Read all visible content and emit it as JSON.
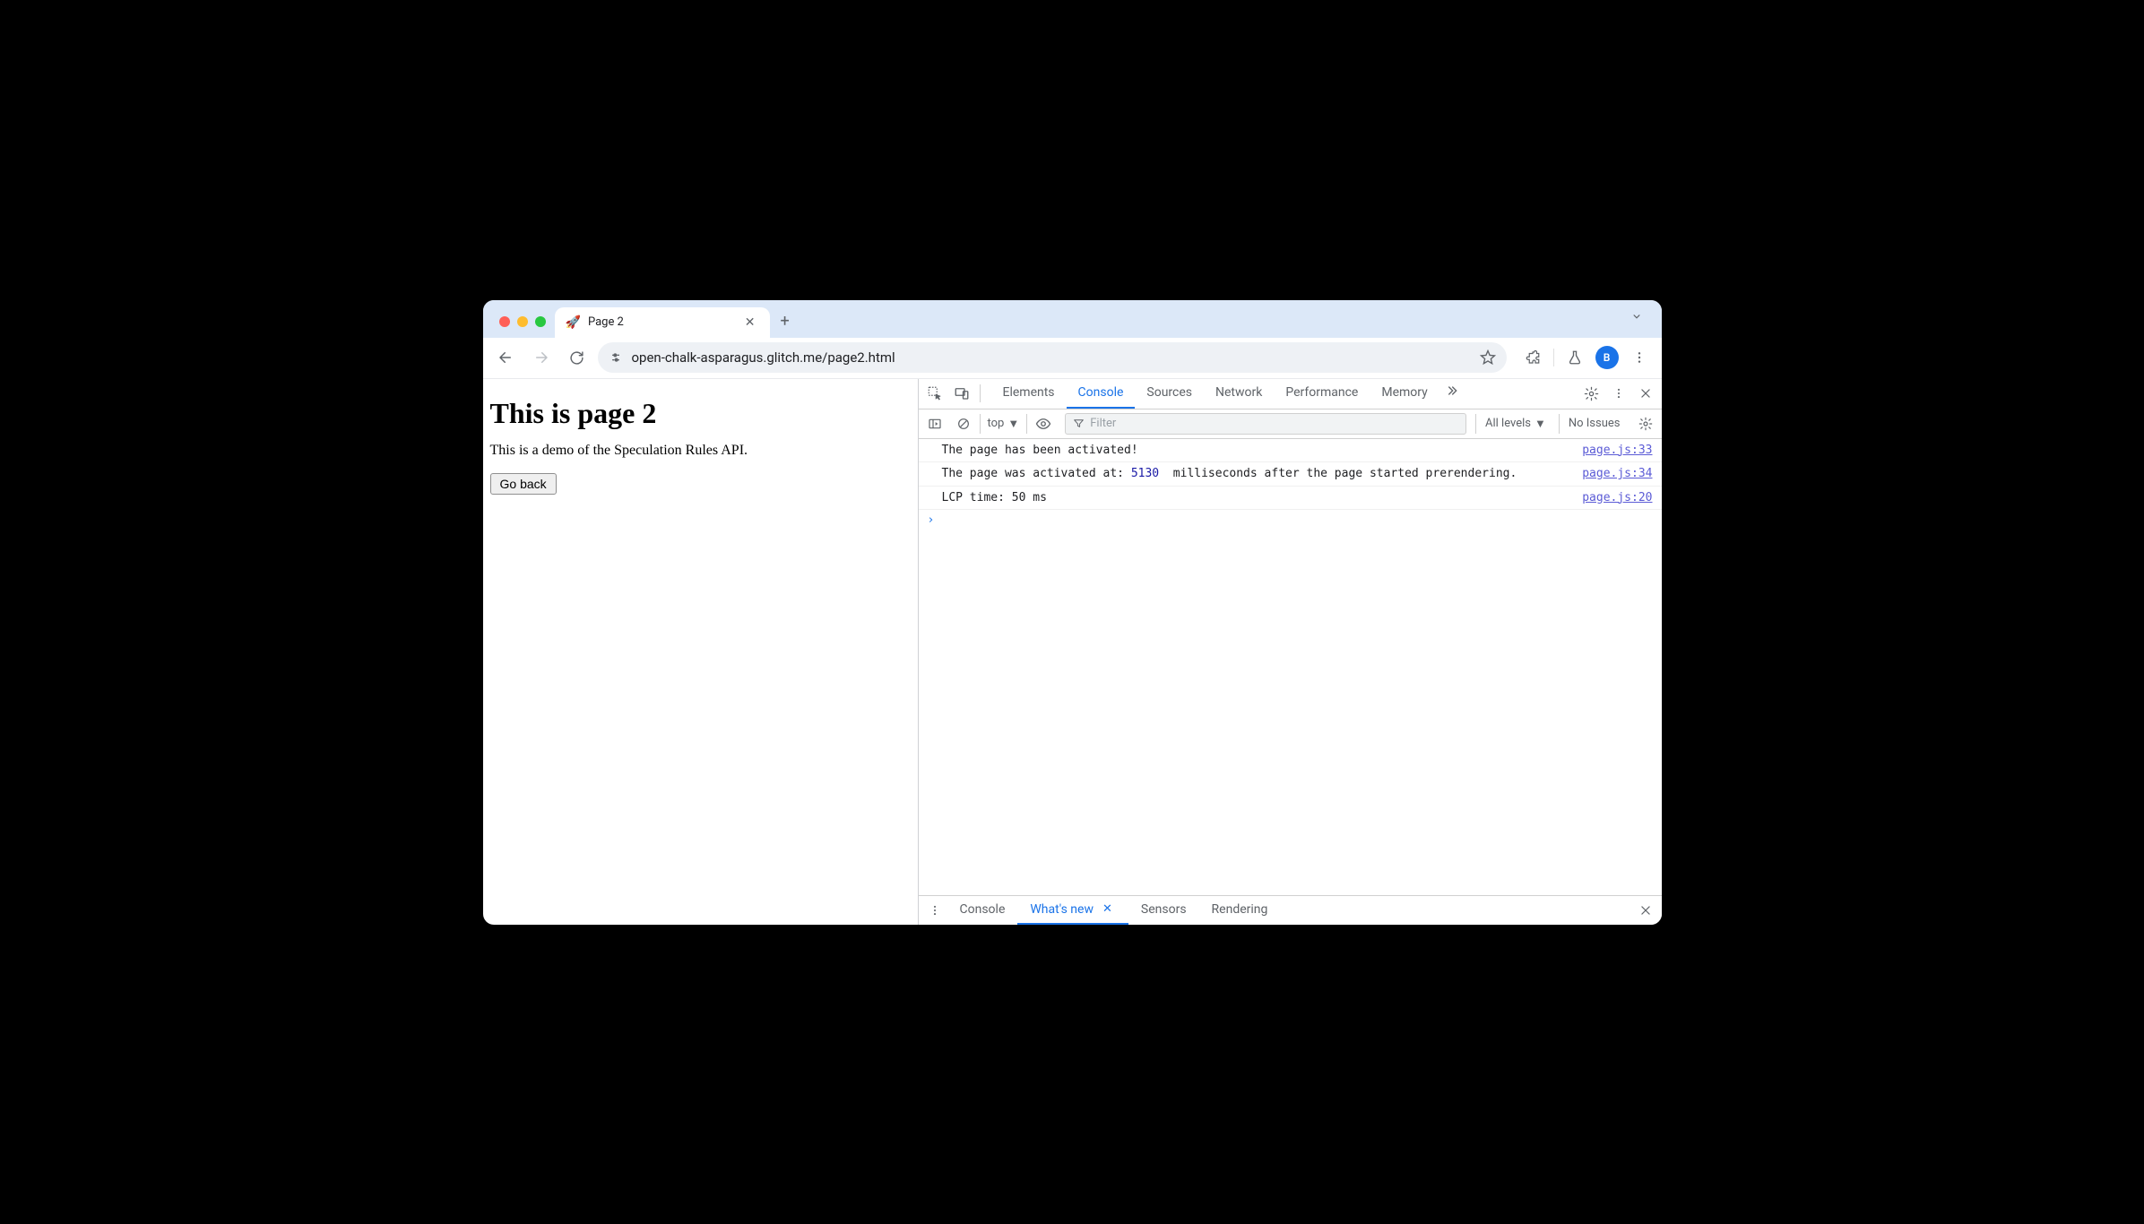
{
  "tab": {
    "favicon": "🚀",
    "title": "Page 2"
  },
  "url": "open-chalk-asparagus.glitch.me/page2.html",
  "avatar_initial": "B",
  "page": {
    "heading": "This is page 2",
    "paragraph": "This is a demo of the Speculation Rules API.",
    "back_button": "Go back"
  },
  "devtools": {
    "tabs": [
      "Elements",
      "Console",
      "Sources",
      "Network",
      "Performance",
      "Memory"
    ],
    "active_tab": "Console",
    "context": "top",
    "filter_placeholder": "Filter",
    "levels": "All levels",
    "issues": "No Issues",
    "messages": [
      {
        "text_before": "The page has been activated!",
        "num": "",
        "text_after": "",
        "source": "page.js:33"
      },
      {
        "text_before": "The page was activated at: ",
        "num": "5130",
        "text_after": "  milliseconds after the page started prerendering.",
        "source": "page.js:34"
      },
      {
        "text_before": "LCP time: 50 ms",
        "num": "",
        "text_after": "",
        "source": "page.js:20"
      }
    ],
    "drawer": {
      "tabs": [
        "Console",
        "What's new",
        "Sensors",
        "Rendering"
      ],
      "active": "What's new"
    }
  }
}
